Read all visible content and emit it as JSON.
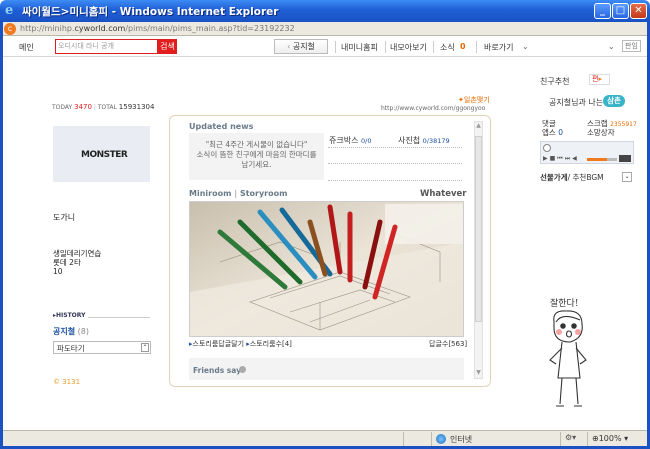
{
  "window": {
    "title": "싸이월드>미니홈피 - Windows Internet Explorer",
    "url_prefix": "http://minihp.",
    "url_domain": "cyworld.com",
    "url_suffix": "/pims/main/pims_main.asp?tid=23192232"
  },
  "nav": {
    "home": "메인",
    "search_placeholder": "오디시대 라니 공개",
    "search_button": "검색",
    "notice": "공지철",
    "minihompy": "내미니홈피",
    "my_view": "내모아보기",
    "news": "소식",
    "news_count": "0",
    "shortcut": "바로가기",
    "login": "판임"
  },
  "left": {
    "today_label": "TODAY",
    "today_value": "3470",
    "total_label": "TOTAL",
    "total_value": "15931304",
    "logo_text": "MONSTER",
    "name_line": "도가니",
    "profile_line1": "생일데리기연습",
    "profile_line2": "롯데 2타",
    "profile_line3": "10",
    "history_label": "HISTORY",
    "notice_board": "공지철",
    "notice_count": "(8)",
    "select_value": "파도타기",
    "footer_mark": "© 3131"
  },
  "main": {
    "ilchon_link": "일촌맺기",
    "homepage_url": "http://www.cyworld.com/ggongyoo",
    "updated_news": "Updated news",
    "no_posts_line1": "\"최근 4주간 게시물이 없습니다\"",
    "no_posts_line2": "소식이 뜸한 친구에게 마음의 한마디를",
    "no_posts_line3": "남기세요.",
    "jukebox_label": "쥬크박스",
    "jukebox_count": "0/0",
    "photo_label": "사진첩",
    "photo_count": "0/38179",
    "miniroom": "Miniroom",
    "storyroom": "Storyroom",
    "whatever": "Whatever",
    "story_link1": "스토리룸답글달기",
    "story_link2": "스토리룸수[4]",
    "reply_count": "답글수[563]",
    "friends_say": "Friends say"
  },
  "right": {
    "friend_recommend": "친구추천",
    "recommend_btn": "편",
    "relation_text": "공지철님과 나는",
    "relation_badge": "삼촌",
    "comments_label": "댓글",
    "comments_value": "",
    "scrap_label": "스크랩",
    "scrap_value": "2355917",
    "apps_label": "앱스",
    "apps_value": "0",
    "gift_box": "소망상자",
    "bgm_label": "선물가게",
    "bgm_sub": "/ 추천BGM",
    "doodle_text": "잘한다!"
  },
  "status": {
    "zone": "인터넷",
    "zoom": "100%"
  },
  "colors": {
    "accent_red": "#e21d1d",
    "accent_orange": "#f07a1e",
    "title_blue": "#1f5fd6",
    "badge_teal": "#38b3c8"
  }
}
